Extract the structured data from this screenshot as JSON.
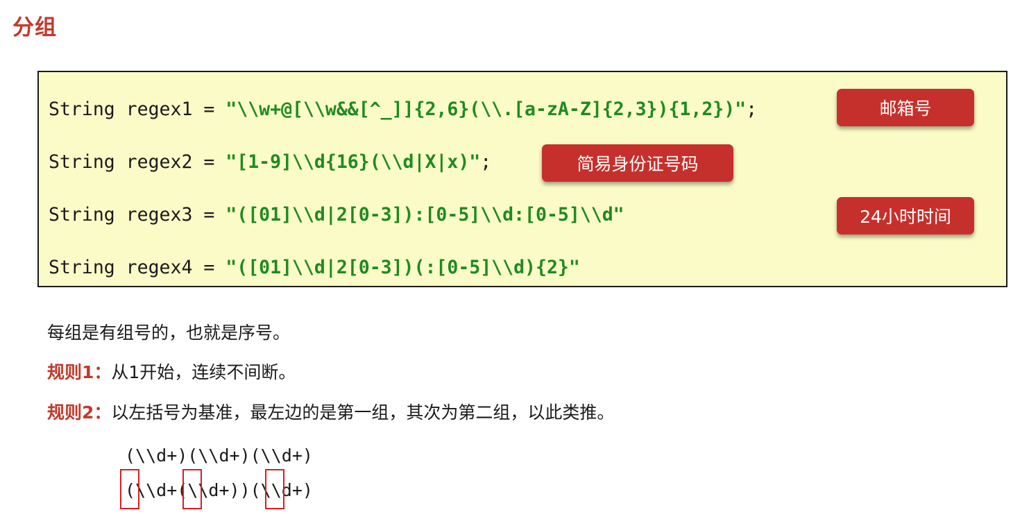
{
  "title": "分组",
  "code": {
    "line1": {
      "prefix": "String regex1 = ",
      "literal": "\"\\\\w+@[\\\\w&&[^_]]{2,6}(\\\\.[a-zA-Z]{2,3}){1,2})\"",
      "suffix": ";"
    },
    "line2": {
      "prefix": "String regex2 = ",
      "literal": "\"[1-9]\\\\d{16}(\\\\d|X|x)\"",
      "suffix": ";"
    },
    "line3": {
      "prefix": "String regex3 = ",
      "literal": "\"([01]\\\\d|2[0-3]):[0-5]\\\\d:[0-5]\\\\d\"",
      "suffix": ""
    },
    "line4": {
      "prefix": "String regex4 = ",
      "literal": "\"([01]\\\\d|2[0-3])(:[0-5]\\\\d){2}\"",
      "suffix": ""
    }
  },
  "badges": {
    "email": "邮箱号",
    "id_card": "简易身份证号码",
    "time24": "24小时时间"
  },
  "text": {
    "intro": "每组是有组号的，也就是序号。",
    "rule1_label": "规则1：",
    "rule1_text": "从1开始，连续不间断。",
    "rule2_label": "规则2：",
    "rule2_text": "以左括号为基准，最左边的是第一组，其次为第二组，以此类推。"
  },
  "examples": {
    "example1": "(\\\\d+)(\\\\d+)(\\\\d+)",
    "example2": "(\\\\d+(\\\\d+))(\\\\d+)"
  },
  "colors": {
    "accent_red": "#c0392b",
    "badge_red": "#c6302c",
    "code_bg": "#fbfbc8",
    "string_green": "#1f8a1f"
  }
}
